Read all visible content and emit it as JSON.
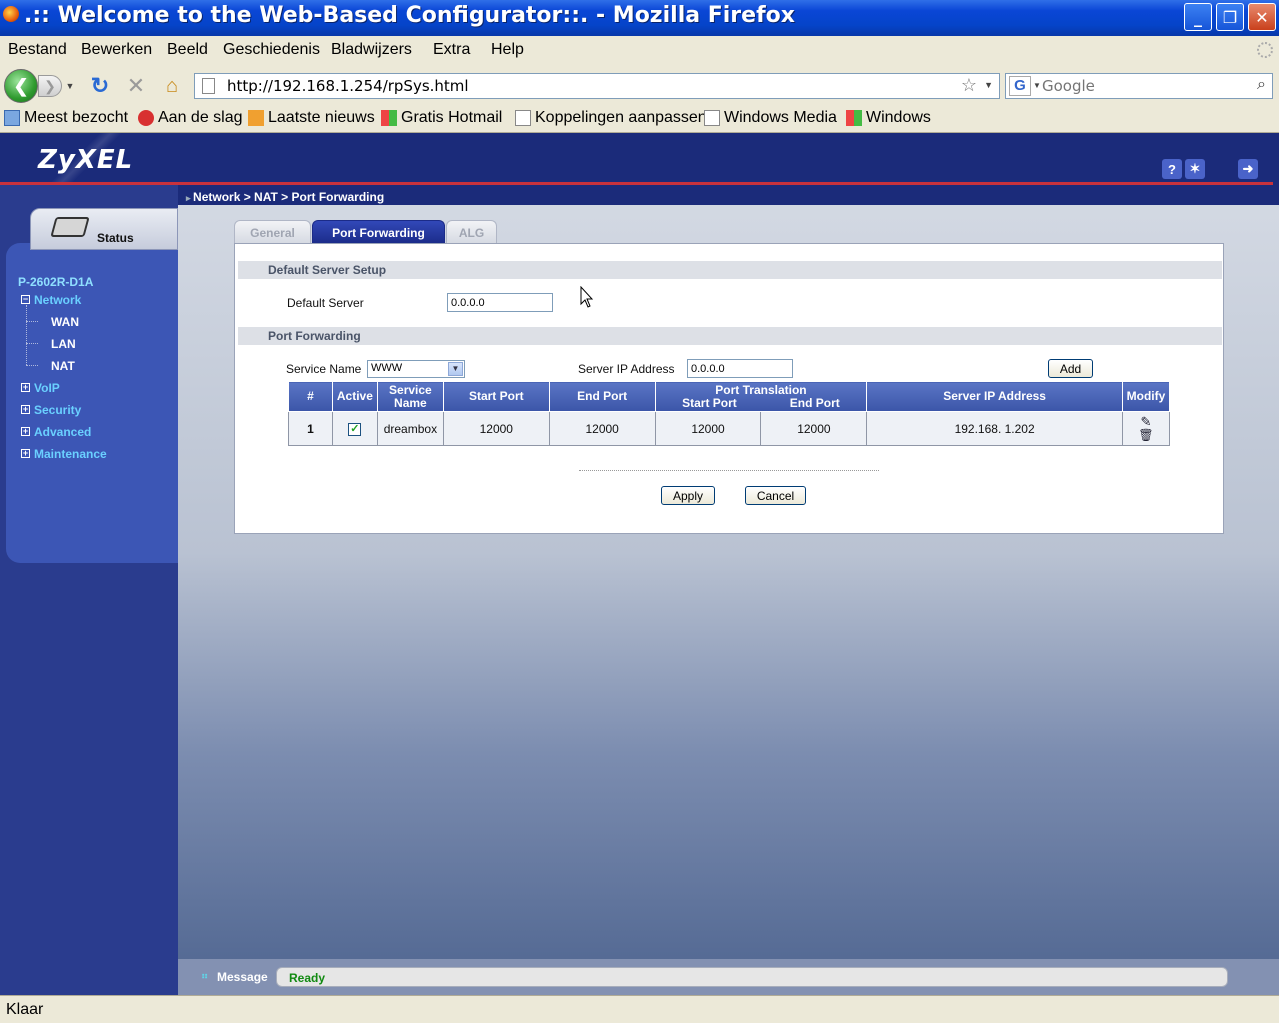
{
  "window": {
    "title": ".:: Welcome to the Web-Based Configurator::. - Mozilla Firefox",
    "minimize": "_",
    "maximize": "❐",
    "close": "✕"
  },
  "menu": [
    "Bestand",
    "Bewerken",
    "Beeld",
    "Geschiedenis",
    "Bladwijzers",
    "Extra",
    "Help"
  ],
  "nav": {
    "url": "http://192.168.1.254/rpSys.html",
    "search_placeholder": "Google"
  },
  "bookmarks": [
    "Meest bezocht",
    "Aan de slag",
    "Laatste nieuws",
    "Gratis Hotmail",
    "Koppelingen aanpassen",
    "Windows Media",
    "Windows"
  ],
  "router": {
    "logo": "ZyXEL",
    "breadcrumb": "Network > NAT > Port Forwarding",
    "status_tab": "Status",
    "model": "P-2602R-D1A",
    "menu": {
      "network": "Network",
      "wan": "WAN",
      "lan": "LAN",
      "nat": "NAT",
      "voip": "VoIP",
      "security": "Security",
      "advanced": "Advanced",
      "maintenance": "Maintenance"
    },
    "tabs": [
      "General",
      "Port Forwarding",
      "ALG"
    ],
    "active_tab": "Port Forwarding"
  },
  "default_server": {
    "section_title": "Default Server Setup",
    "label": "Default Server",
    "value": "0.0.0.0"
  },
  "port_forwarding": {
    "section_title": "Port Forwarding",
    "service_name_label": "Service Name",
    "service_name_value": "WWW",
    "server_ip_label": "Server IP Address",
    "server_ip_value": "0.0.0.0",
    "add_label": "Add",
    "table": {
      "headers": {
        "num": "#",
        "active": "Active",
        "service": "Service",
        "service2": "Name",
        "start": "Start Port",
        "end": "End Port",
        "translation": "Port Translation",
        "tstart": "Start Port",
        "tend": "End Port",
        "server_ip": "Server IP Address",
        "modify": "Modify"
      },
      "rows": [
        {
          "num": "1",
          "active": true,
          "service": "dreambox",
          "start": "12000",
          "end": "12000",
          "tstart": "12000",
          "tend": "12000",
          "server_ip": "192.168. 1.202"
        }
      ]
    },
    "apply_label": "Apply",
    "cancel_label": "Cancel"
  },
  "message": {
    "label": "Message",
    "value": "Ready"
  },
  "statusbar": "Klaar"
}
